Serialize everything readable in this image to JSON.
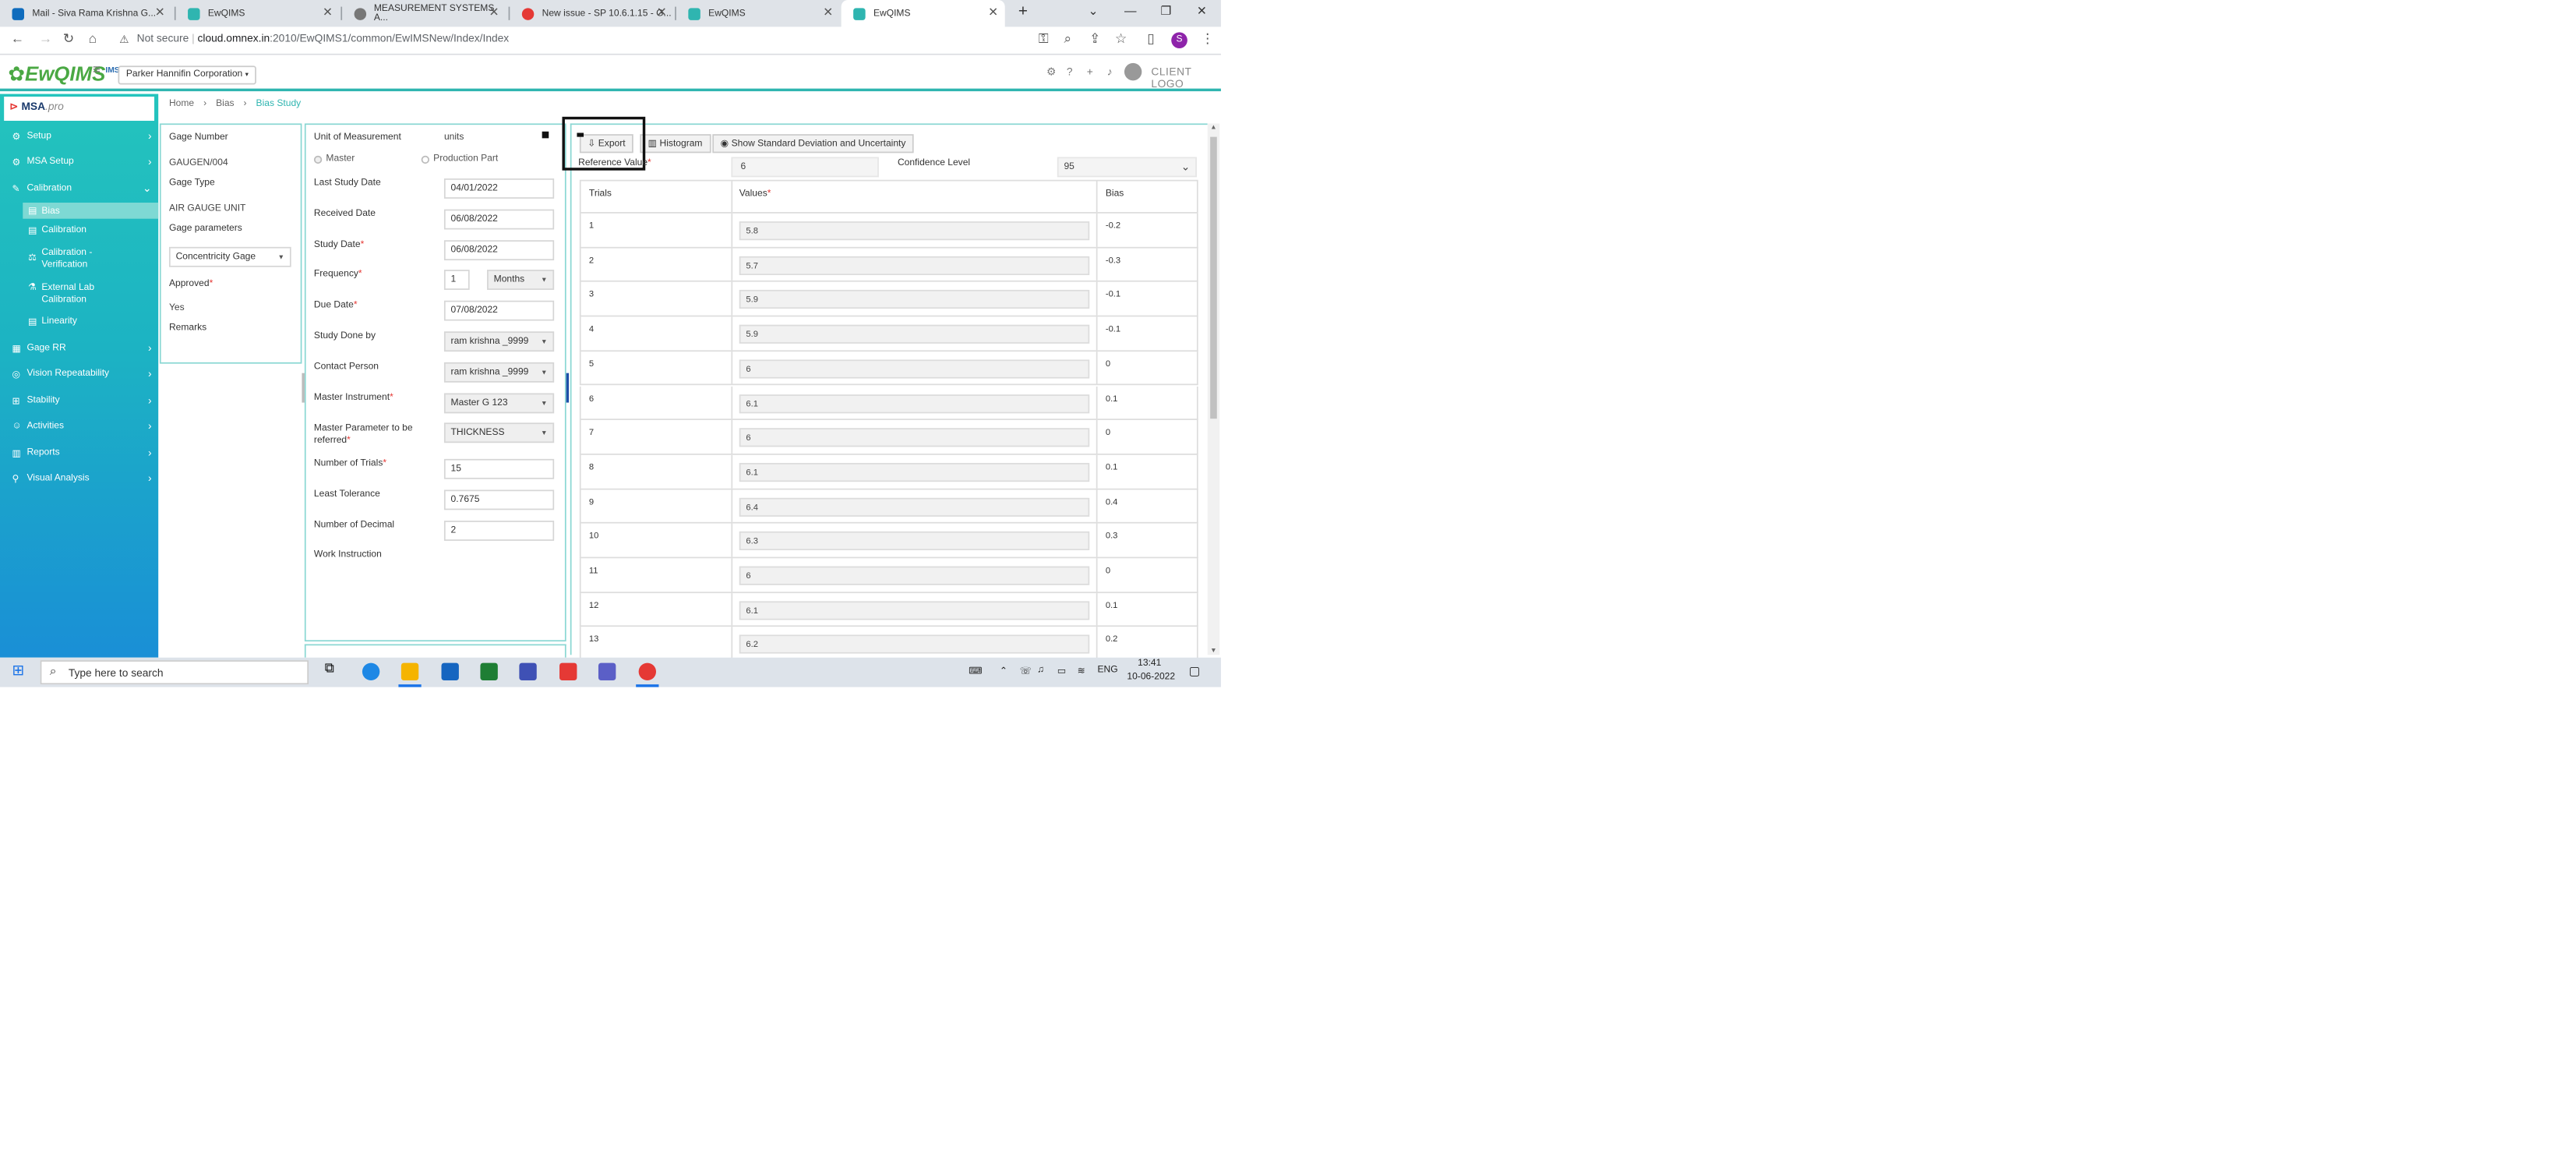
{
  "browser": {
    "tabs": [
      {
        "title": "Mail - Siva Rama Krishna G...",
        "color": "#0f6cbd",
        "left": 0
      },
      {
        "title": "EwQIMS",
        "color": "#2fb5b0"
      },
      {
        "title": "MEASUREMENT SYSTEMS A...",
        "color": "#666"
      },
      {
        "title": "New issue - SP 10.6.1.15 - G...",
        "color": "#e53935"
      },
      {
        "title": "EwQIMS",
        "color": "#2fb5b0"
      },
      {
        "title": "EwQIMS",
        "color": "#2fb5b0"
      }
    ],
    "new_tab": "+",
    "url_prefix": "Not secure",
    "url_host": "cloud.omnex.in",
    "url_path": ":2010/EwQIMS1/common/EwIMSNew/Index/Index"
  },
  "header": {
    "logo": "EwQIMS",
    "logo_sup": "IMS",
    "company": "Parker Hannifin Corporation",
    "client_logo": "CLIENT LOGO"
  },
  "sidebar": {
    "brand": "MSA",
    "brand_suffix": ".pro",
    "items": [
      {
        "label": "Setup",
        "icon": "gear-icon"
      },
      {
        "label": "MSA Setup",
        "icon": "cog-icon"
      },
      {
        "label": "Calibration",
        "icon": "wrench-icon"
      },
      {
        "label": "Gage RR",
        "icon": "grid-icon"
      },
      {
        "label": "Vision Repeatability",
        "icon": "target-icon"
      },
      {
        "label": "Stability",
        "icon": "stability-icon"
      },
      {
        "label": "Activities",
        "icon": "user-icon"
      },
      {
        "label": "Reports",
        "icon": "report-icon"
      },
      {
        "label": "Visual Analysis",
        "icon": "pin-icon"
      }
    ],
    "subitems": [
      {
        "label": "Bias"
      },
      {
        "label": "Calibration"
      },
      {
        "label": "Calibration - Verification"
      },
      {
        "label": "External Lab Calibration"
      },
      {
        "label": "Linearity"
      }
    ]
  },
  "breadcrumb": {
    "home": "Home",
    "bias": "Bias",
    "current": "Bias Study"
  },
  "gage_panel": {
    "gage_number_label": "Gage Number",
    "gage_number": "GAUGEN/004",
    "gage_type_label": "Gage Type",
    "gage_type": "AIR GAUGE UNIT",
    "gage_parameters_label": "Gage parameters",
    "gage_parameter": "Concentricity Gage",
    "approved_label": "Approved",
    "approved": "Yes",
    "remarks_label": "Remarks"
  },
  "study_form": {
    "unit_label": "Unit of Measurement",
    "unit": "units",
    "radio_master": "Master",
    "radio_production": "Production Part",
    "last_study_label": "Last Study Date",
    "last_study": "04/01/2022",
    "received_label": "Received Date",
    "received": "06/08/2022",
    "study_date_label": "Study Date",
    "study_date": "06/08/2022",
    "frequency_label": "Frequency",
    "frequency": "1",
    "frequency_unit": "Months",
    "due_label": "Due Date",
    "due": "07/08/2022",
    "done_by_label": "Study Done by",
    "done_by": "ram krishna _9999",
    "contact_label": "Contact Person",
    "contact": "ram krishna _9999",
    "master_instr_label": "Master Instrument",
    "master_instr": "Master G 123",
    "master_param_label_1": "Master Parameter to be",
    "master_param_label_2": "referred",
    "master_param": "THICKNESS",
    "trials_label": "Number of Trials",
    "trials": "15",
    "tolerance_label": "Least Tolerance",
    "tolerance": "0.7675",
    "decimal_label": "Number of Decimal",
    "decimal": "2",
    "work_instruction_label": "Work Instruction"
  },
  "results": {
    "export": "Export",
    "histogram": "Histogram",
    "show_std": "Show Standard Deviation and Uncertainty",
    "reference_label": "Reference Value",
    "reference": "6",
    "confidence_label": "Confidence Level",
    "confidence": "95",
    "columns": {
      "trials": "Trials",
      "values": "Values",
      "bias": "Bias"
    },
    "rows": [
      {
        "trial": "1",
        "value": "5.8",
        "bias": "-0.2"
      },
      {
        "trial": "2",
        "value": "5.7",
        "bias": "-0.3"
      },
      {
        "trial": "3",
        "value": "5.9",
        "bias": "-0.1"
      },
      {
        "trial": "4",
        "value": "5.9",
        "bias": "-0.1"
      },
      {
        "trial": "5",
        "value": "6",
        "bias": "0"
      },
      {
        "trial": "6",
        "value": "6.1",
        "bias": "0.1"
      },
      {
        "trial": "7",
        "value": "6",
        "bias": "0"
      },
      {
        "trial": "8",
        "value": "6.1",
        "bias": "0.1"
      },
      {
        "trial": "9",
        "value": "6.4",
        "bias": "0.4"
      },
      {
        "trial": "10",
        "value": "6.3",
        "bias": "0.3"
      },
      {
        "trial": "11",
        "value": "6",
        "bias": "0"
      },
      {
        "trial": "12",
        "value": "6.1",
        "bias": "0.1"
      },
      {
        "trial": "13",
        "value": "6.2",
        "bias": "0.2"
      }
    ]
  },
  "taskbar": {
    "search": "Type here to search",
    "lang": "ENG",
    "time": "13:41",
    "date": "10-06-2022"
  }
}
